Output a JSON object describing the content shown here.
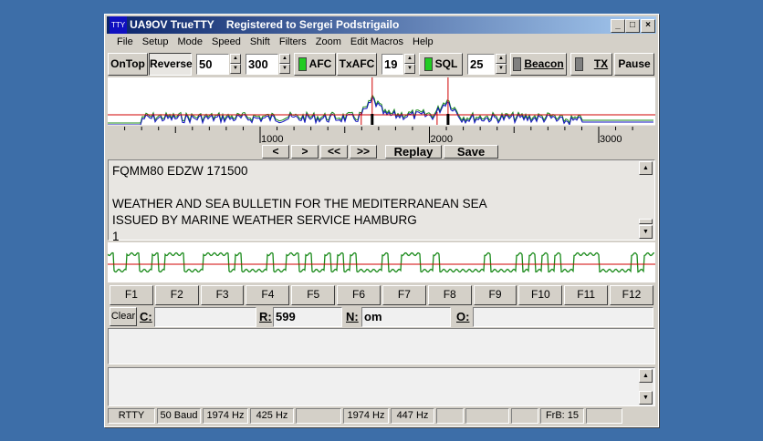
{
  "window": {
    "icon": "TTY",
    "title": "UA9OV TrueTTY    Registered to Sergei Podstrigailo",
    "min": "_",
    "max": "□",
    "close": "×"
  },
  "menu": [
    "File",
    "Setup",
    "Mode",
    "Speed",
    "Shift",
    "Filters",
    "Zoom",
    "Edit Macros",
    "Help"
  ],
  "toolbar": {
    "ontop": "OnTop",
    "reverse": "Reverse",
    "speed": "50",
    "shift": "300",
    "afc": "AFC",
    "txafc": "TxAFC",
    "squelch_val": "19",
    "sql": "SQL",
    "beacon_val": "25",
    "beacon": "Beacon",
    "tx": "TX",
    "pause": "Pause",
    "led_on": "#22cc22",
    "led_off": "#808080"
  },
  "spectrum": {
    "ticks": [
      "1000",
      "2000",
      "3000"
    ],
    "markers_hz": [
      1662,
      2110
    ],
    "peaks_hz": [
      1662,
      2110
    ]
  },
  "nav": {
    "prev": "<",
    "next": ">",
    "prev_fast": "<<",
    "next_fast": ">>",
    "replay": "Replay",
    "save": "Save"
  },
  "rx_text": [
    "FQMM80 EDZW 171500",
    "",
    "WEATHER AND SEA BULLETIN FOR THE MEDITERRANEAN SEA",
    "ISSUED BY MARINE WEATHER SERVICE HAMBURG",
    "1"
  ],
  "fkeys": [
    "F1",
    "F2",
    "F3",
    "F4",
    "F5",
    "F6",
    "F7",
    "F8",
    "F9",
    "F10",
    "F11",
    "F12"
  ],
  "fields": {
    "clear": "Clear",
    "c_label": "C:",
    "c_value": "",
    "r_label": "R:",
    "r_value": "599",
    "n_label": "N:",
    "n_value": "om",
    "o_label": "O:",
    "o_value": ""
  },
  "status": [
    "RTTY",
    "50 Baud",
    "1974 Hz",
    "425 Hz",
    "",
    "1974 Hz",
    "447 Hz",
    "",
    "",
    "",
    "FrB: 15",
    ""
  ]
}
